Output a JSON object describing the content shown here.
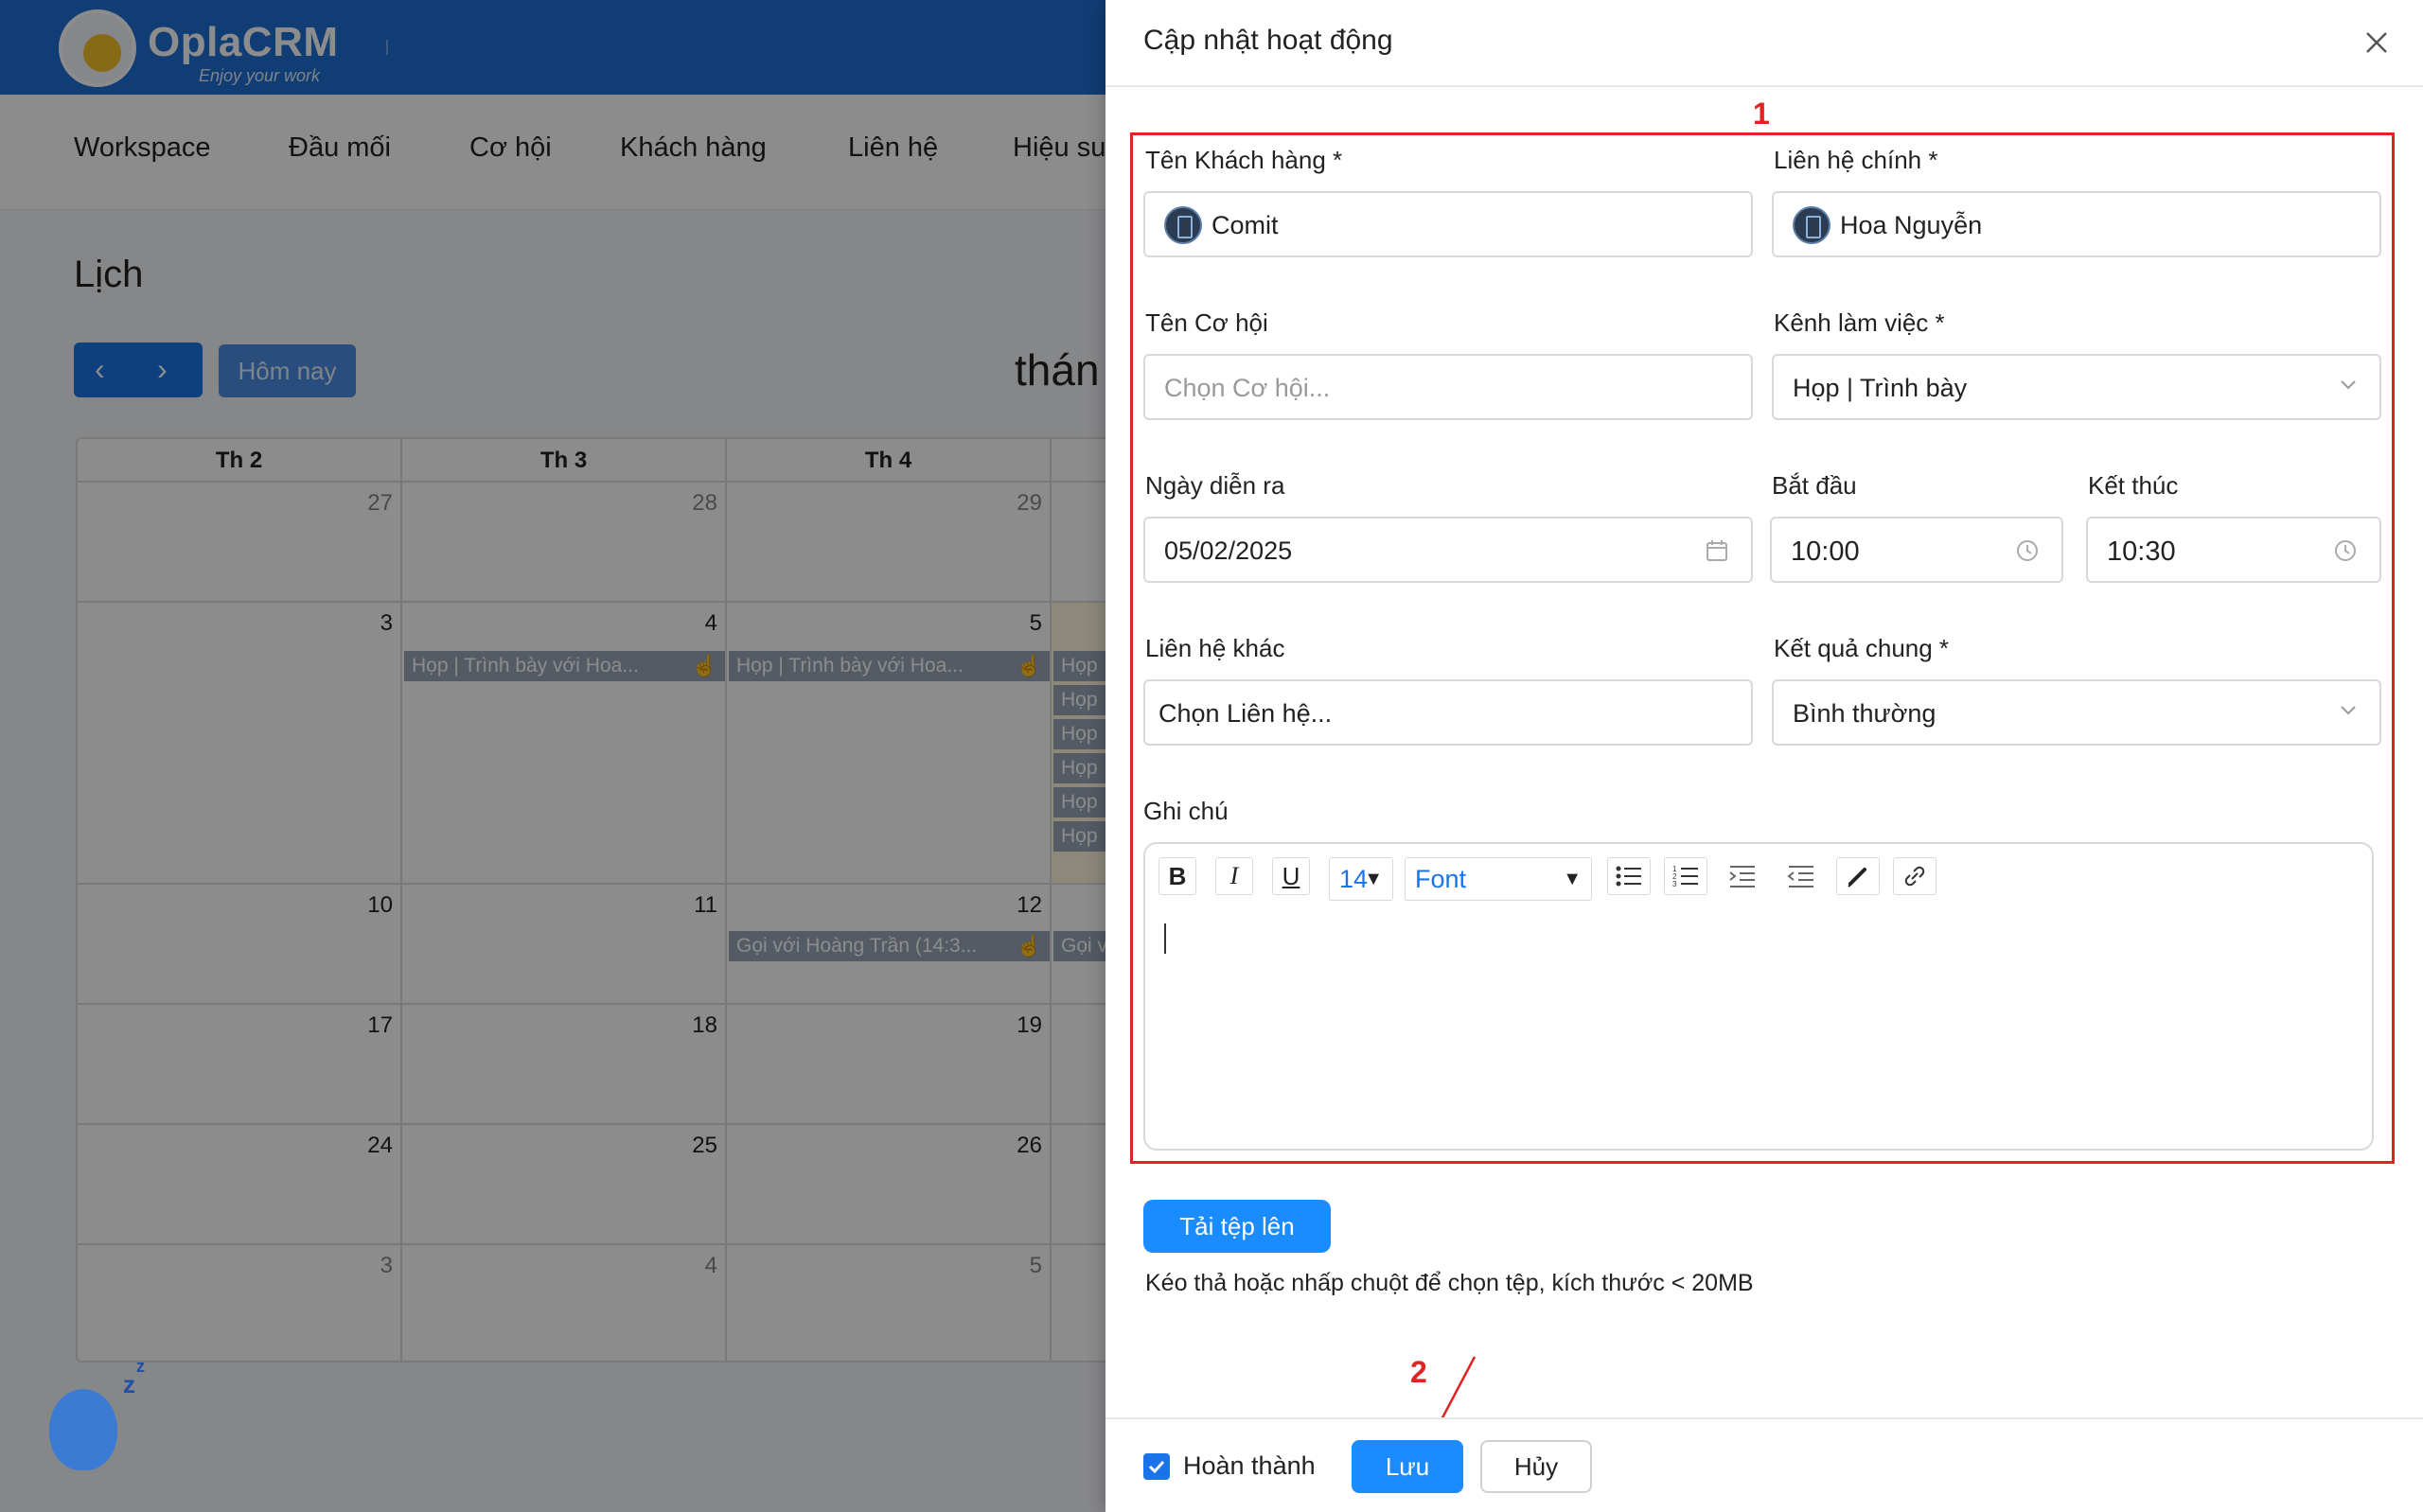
{
  "app": {
    "logo_name": "OplaCRM",
    "logo_tagline": "Enjoy your work",
    "nav": [
      "Workspace",
      "Đầu mối",
      "Cơ hội",
      "Khách hàng",
      "Liên hệ",
      "Hiệu su"
    ],
    "page_title": "Lịch",
    "today_label": "Hôm nay",
    "month_label": "thán",
    "prev_icon": "chevron-left-icon",
    "next_icon": "chevron-right-icon"
  },
  "calendar": {
    "headers": [
      "Th 2",
      "Th 3",
      "Th 4"
    ],
    "weeks": [
      [
        "27",
        "28",
        "29"
      ],
      [
        "3",
        "4",
        "5"
      ],
      [
        "10",
        "11",
        "12"
      ],
      [
        "17",
        "18",
        "19"
      ],
      [
        "24",
        "25",
        "26"
      ],
      [
        "3",
        "4",
        "5"
      ]
    ],
    "events": {
      "tue_4": "Họp | Trình bày với Hoa...",
      "wed_5": "Họp | Trình bày với Hoa...",
      "wed_12": "Gọi với Hoàng Trần (14:3...",
      "thu_col": [
        "Họp",
        "Họp",
        "Họp",
        "Họp",
        "Họp",
        "Họp"
      ],
      "thu_12": "Gọi v"
    }
  },
  "drawer": {
    "title": "Cập nhật hoạt động",
    "close_icon": "close-icon",
    "annotations": {
      "box_number": "1",
      "arrow_number": "2"
    },
    "fields": {
      "customer": {
        "label": "Tên Khách hàng *",
        "value": "Comit"
      },
      "main_contact": {
        "label": "Liên hệ chính *",
        "value": "Hoa Nguyễn"
      },
      "opportunity": {
        "label": "Tên Cơ hội",
        "placeholder": "Chọn Cơ hội..."
      },
      "channel": {
        "label": "Kênh làm việc *",
        "value": "Họp | Trình bày"
      },
      "date": {
        "label": "Ngày diễn ra",
        "value": "05/02/2025"
      },
      "start": {
        "label": "Bắt đầu",
        "value": "10:00"
      },
      "end": {
        "label": "Kết thúc",
        "value": "10:30"
      },
      "other_contacts": {
        "label": "Liên hệ khác",
        "value": "Chọn Liên hệ..."
      },
      "result": {
        "label": "Kết quả chung *",
        "value": "Bình thường"
      },
      "notes": {
        "label": "Ghi chú",
        "value": ""
      }
    },
    "editor_toolbar": {
      "bold": "B",
      "italic": "I",
      "underline": "U",
      "font_size": "14",
      "font_name": "Font"
    },
    "upload": {
      "button": "Tải tệp lên",
      "hint": "Kéo thả hoặc nhấp chuột để chọn tệp, kích thước < 20MB"
    },
    "footer": {
      "complete_label": "Hoàn thành",
      "complete_checked": true,
      "save_label": "Lưu",
      "cancel_label": "Hủy"
    }
  },
  "colors": {
    "primary": "#1a73e8",
    "annotation_red": "#e02424",
    "topbar": "#1f6fd6"
  }
}
